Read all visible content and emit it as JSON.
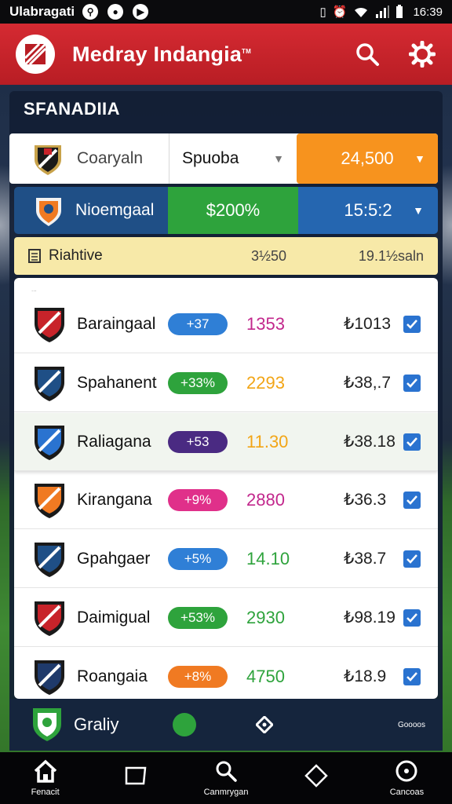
{
  "status_bar": {
    "carrier": "Ulabragati",
    "icons": [
      "vpn-icon",
      "shield-icon",
      "play-icon"
    ],
    "time": "16:39"
  },
  "app_bar": {
    "title": "Medray Indangia",
    "trademark": "TM",
    "search_icon": "search-icon",
    "settings_icon": "gear-icon",
    "brand_color": "#d52a32"
  },
  "section": {
    "title": "SFANADIIA"
  },
  "selector_row": {
    "team": "Coaryaln",
    "select_value": "Spuoba",
    "amount": "24,500"
  },
  "featured_row": {
    "team": "Nioemgaal",
    "price": "$200%",
    "time": "15:5:2"
  },
  "summary": {
    "label": "Riahtive",
    "value": "3½50",
    "extra": "19.1½saln"
  },
  "list": {
    "caption": "...",
    "items": [
      {
        "name": "Baraingaal",
        "badge": "+37",
        "badge_color": "#2f7fd6",
        "number": "1353",
        "number_color": "#c2278c",
        "price": "₺1013",
        "checked": true
      },
      {
        "name": "Spahanent",
        "badge": "+33%",
        "badge_color": "#2ea33c",
        "number": "2293",
        "number_color": "#f2a516",
        "price": "₺38,.7",
        "checked": true
      },
      {
        "name": "Raliagana",
        "badge": "+53",
        "badge_color": "#4a2a82",
        "number": "11.30",
        "number_color": "#f2a516",
        "price": "₺38.18",
        "checked": true
      },
      {
        "name": "Kirangana",
        "badge": "+9%",
        "badge_color": "#e0308a",
        "number": "2880",
        "number_color": "#c2278c",
        "price": "₺36.3",
        "checked": true
      },
      {
        "name": "Gpahgaer",
        "badge": "+5%",
        "badge_color": "#2f7fd6",
        "number": "14.10",
        "number_color": "#2ea33c",
        "price": "₺38.7",
        "checked": true
      },
      {
        "name": "Daimigual",
        "badge": "+53%",
        "badge_color": "#2ea33c",
        "number": "2930",
        "number_color": "#2ea33c",
        "price": "₺98.19",
        "checked": true
      },
      {
        "name": "Roangaia",
        "badge": "+8%",
        "badge_color": "#f07a22",
        "number": "4750",
        "number_color": "#2ea33c",
        "price": "₺18.9",
        "checked": true
      }
    ]
  },
  "footer_bar": {
    "label": "Graliy",
    "small_text": "Goooos"
  },
  "bottom_nav": {
    "tabs": [
      {
        "label": "Fenacit",
        "icon": "home-icon"
      },
      {
        "label": "",
        "icon": "square-icon"
      },
      {
        "label": "Canmrygan",
        "icon": "search-icon"
      },
      {
        "label": "",
        "icon": "diamond-icon"
      },
      {
        "label": "Cancoas",
        "icon": "circle-icon"
      }
    ]
  }
}
